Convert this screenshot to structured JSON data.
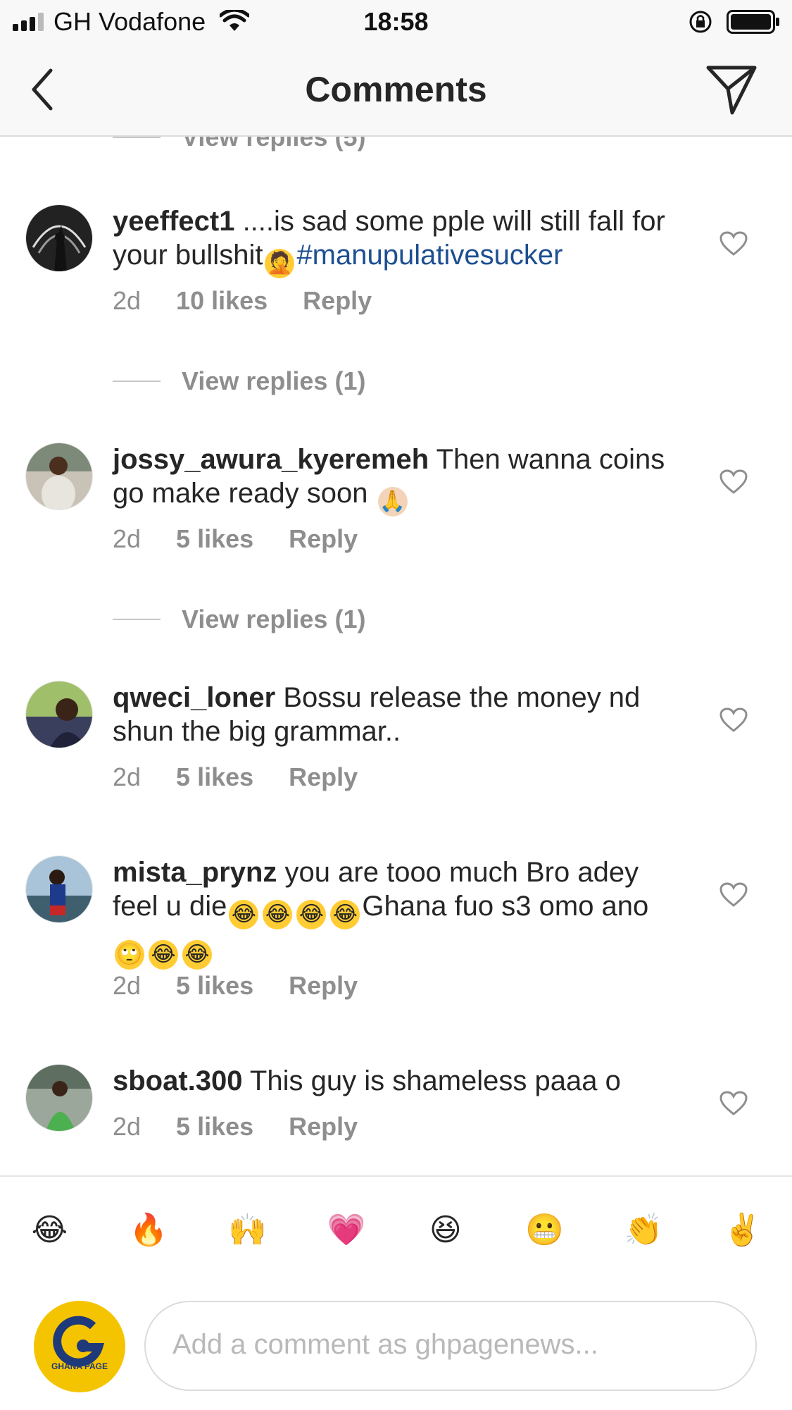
{
  "status_bar": {
    "carrier": "GH Vodafone",
    "time": "18:58"
  },
  "nav": {
    "title": "Comments"
  },
  "top_view_replies": "View replies (5)",
  "comments": [
    {
      "username": "yeeffect1",
      "text_before": "....is sad some pple will still fall for your bullshit",
      "emoji_after_text": "facepalm",
      "hashtag": "#manupulativesucker",
      "time": "2d",
      "likes": "10 likes",
      "reply": "Reply",
      "view_replies": "View replies (1)"
    },
    {
      "username": "jossy_awura_kyeremeh",
      "text": "Then wanna coins go make ready soon",
      "emoji_after_text": "folded-hands",
      "time": "2d",
      "likes": "5 likes",
      "reply": "Reply",
      "view_replies": "View replies (1)"
    },
    {
      "username": "qweci_loner",
      "text": "Bossu release the money nd shun the big grammar..",
      "time": "2d",
      "likes": "5 likes",
      "reply": "Reply"
    },
    {
      "username": "mista_prynz",
      "text_1": "you are tooo much Bro adey feel u die",
      "text_2": "Ghana fuo s3 omo ano",
      "time": "2d",
      "likes": "5 likes",
      "reply": "Reply"
    },
    {
      "username": "sboat.300",
      "text": "This guy is shameless paaa o",
      "time": "2d",
      "likes": "5 likes",
      "reply": "Reply"
    }
  ],
  "quick_emojis": [
    "😂",
    "🔥",
    "🙌",
    "💗",
    "😆",
    "😬",
    "👏",
    "✌️"
  ],
  "composer": {
    "placeholder": "Add a comment as ghpagenews...",
    "avatar_text": "GHANA PAGE"
  },
  "colors": {
    "hashtag": "#1d4f91",
    "muted": "#8e8e8e",
    "text": "#262626",
    "avatar_brand": "#f5c400"
  }
}
